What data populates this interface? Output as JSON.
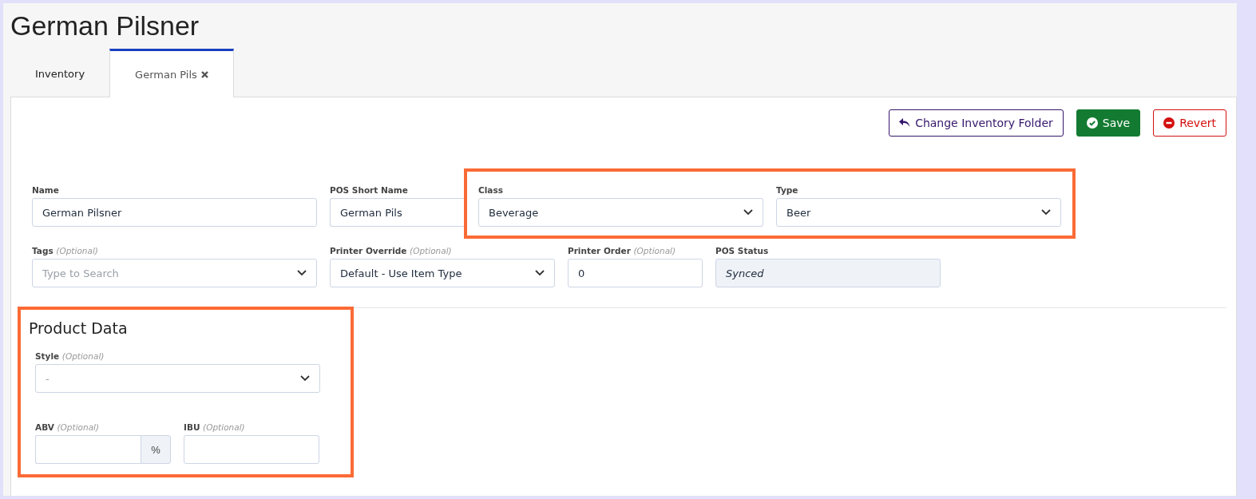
{
  "title": "German Pilsner",
  "tabs": [
    {
      "label": "Inventory",
      "selected": false,
      "closable": false
    },
    {
      "label": "German Pils",
      "selected": true,
      "closable": true
    }
  ],
  "actions": [
    {
      "label": "Change Inventory Folder",
      "kind": "folder"
    },
    {
      "label": "Save",
      "kind": "save"
    },
    {
      "label": "Revert",
      "kind": "revert"
    }
  ],
  "fields_row_1": [
    {
      "label": "Name",
      "kind": "text",
      "value": "German Pilsner"
    },
    {
      "label": "POS Short Name",
      "kind": "text",
      "value": "German Pils"
    }
  ],
  "highlighted_fields": [
    {
      "label": "Class",
      "kind": "select",
      "value": "Beverage"
    },
    {
      "label": "Type",
      "kind": "select",
      "value": "Beer"
    }
  ],
  "fields_row_2": [
    {
      "label": "Tags",
      "optional": "(Optional)",
      "kind": "select",
      "placeholder": "Type to Search"
    },
    {
      "label": "Printer Override",
      "optional": "(Optional)",
      "kind": "select",
      "value": "Default - Use Item Type"
    },
    {
      "label": "Printer Order",
      "optional": "(Optional)",
      "kind": "text",
      "value": "0"
    },
    {
      "label": "POS Status",
      "kind": "readonly",
      "value": "Synced"
    }
  ],
  "product_data": {
    "title": "Product Data",
    "style": {
      "label": "Style",
      "optional": "(Optional)",
      "kind": "select",
      "placeholder": "-"
    },
    "measures": [
      {
        "label": "ABV",
        "optional": "(Optional)",
        "kind": "addon",
        "addon": "%"
      },
      {
        "label": "IBU",
        "optional": "(Optional)",
        "kind": "text"
      }
    ]
  }
}
